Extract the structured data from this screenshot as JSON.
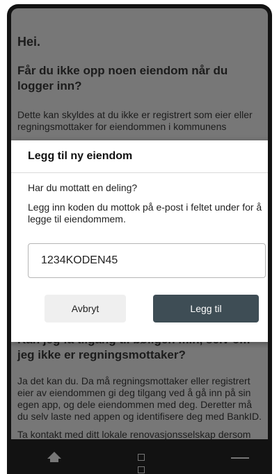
{
  "screen": {
    "greeting": "Hei.",
    "faq1_title": "Får du ikke opp noen eiendom når du logger inn?",
    "faq1_text": "Dette kan skyldes at du ikke er registrert som eier eller regningsmottaker for eiendommen i kommunens",
    "faq2_title": "Kan jeg få tilgang til bøllgen min, selv om jeg ikke er regningsmottaker?",
    "faq2_text": "Ja det kan du. Da må regningsmottaker eller registrert eier av eiendommen gi deg tilgang ved å gå inn på sin egen app, og dele eiendommen med deg. Deretter må du selv laste ned appen og identifisere deg med BankID.",
    "contact_text": "Ta kontakt med ditt lokale renovasjonsselskap dersom du har spørsmål."
  },
  "dialog": {
    "title": "Legg til ny eiendom",
    "question": "Har du mottatt en deling?",
    "description": "Legg inn koden du mottok på e-post i feltet under for å legge til eiendommem.",
    "code_value": "1234KODEN45",
    "cancel_label": "Avbryt",
    "add_label": "Legg til"
  },
  "navbar": {
    "icons": [
      "home-icon",
      "recent-apps-icon",
      "menu-icon"
    ]
  }
}
